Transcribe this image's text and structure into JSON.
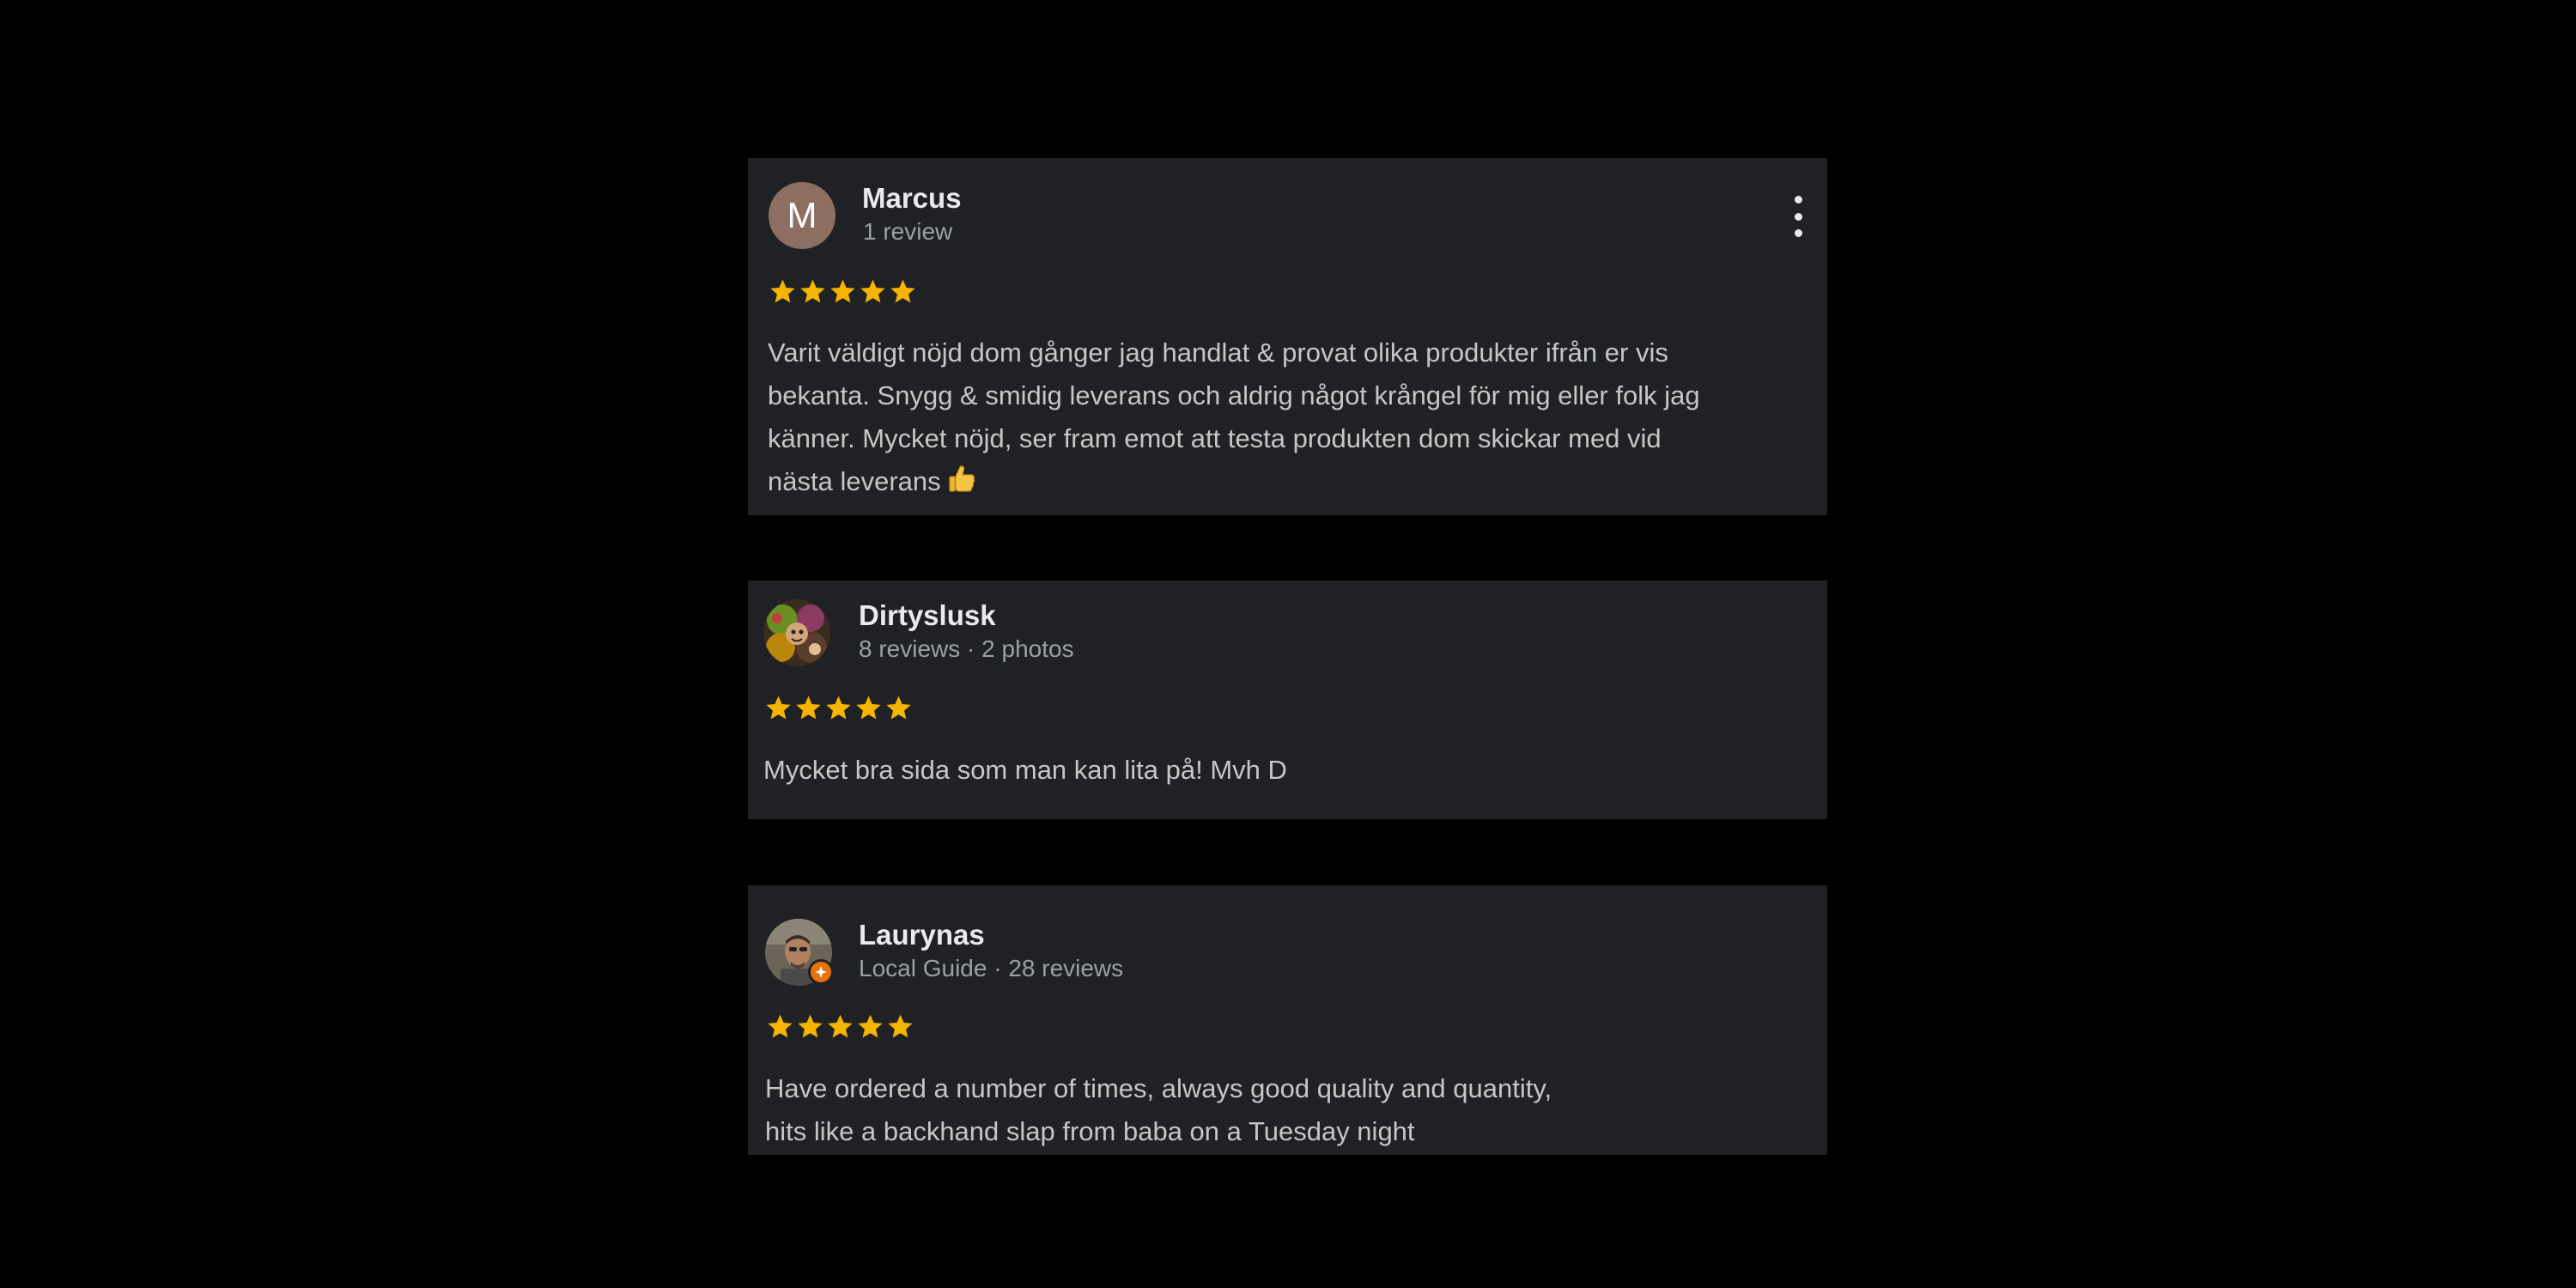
{
  "reviews": [
    {
      "author": "Marcus",
      "avatar_letter": "M",
      "avatar_color": "#8d6e63",
      "meta": "1 review",
      "rating": 5,
      "text_lines": [
        "Varit väldigt nöjd dom gånger jag handlat & provat olika produkter ifrån er vis",
        "bekanta. Snygg & smidig leverans och aldrig något krångel för mig eller folk jag",
        "känner. Mycket nöjd, ser fram emot att testa produkten dom skickar med vid",
        "nästa leverans"
      ],
      "emoji": "thumbs-up",
      "has_more_menu": true
    },
    {
      "author": "Dirtyslusk",
      "meta": "8 reviews · 2 photos",
      "rating": 5,
      "text_lines": [
        "Mycket bra sida som man kan lita på! Mvh D"
      ]
    },
    {
      "author": "Laurynas",
      "meta": "Local Guide · 28 reviews",
      "rating": 5,
      "local_guide_badge": true,
      "text_lines": [
        "Have ordered a number of times, always good quality and quantity,",
        "hits like a backhand slap from baba on a Tuesday night"
      ]
    }
  ],
  "colors": {
    "page_background": "#000000",
    "card_background": "#202124",
    "star": "#f4b400",
    "name": "#e8eaed",
    "meta": "#9aa0a6",
    "text": "#c4c7c5",
    "local_guide_badge": "#e8710a"
  }
}
